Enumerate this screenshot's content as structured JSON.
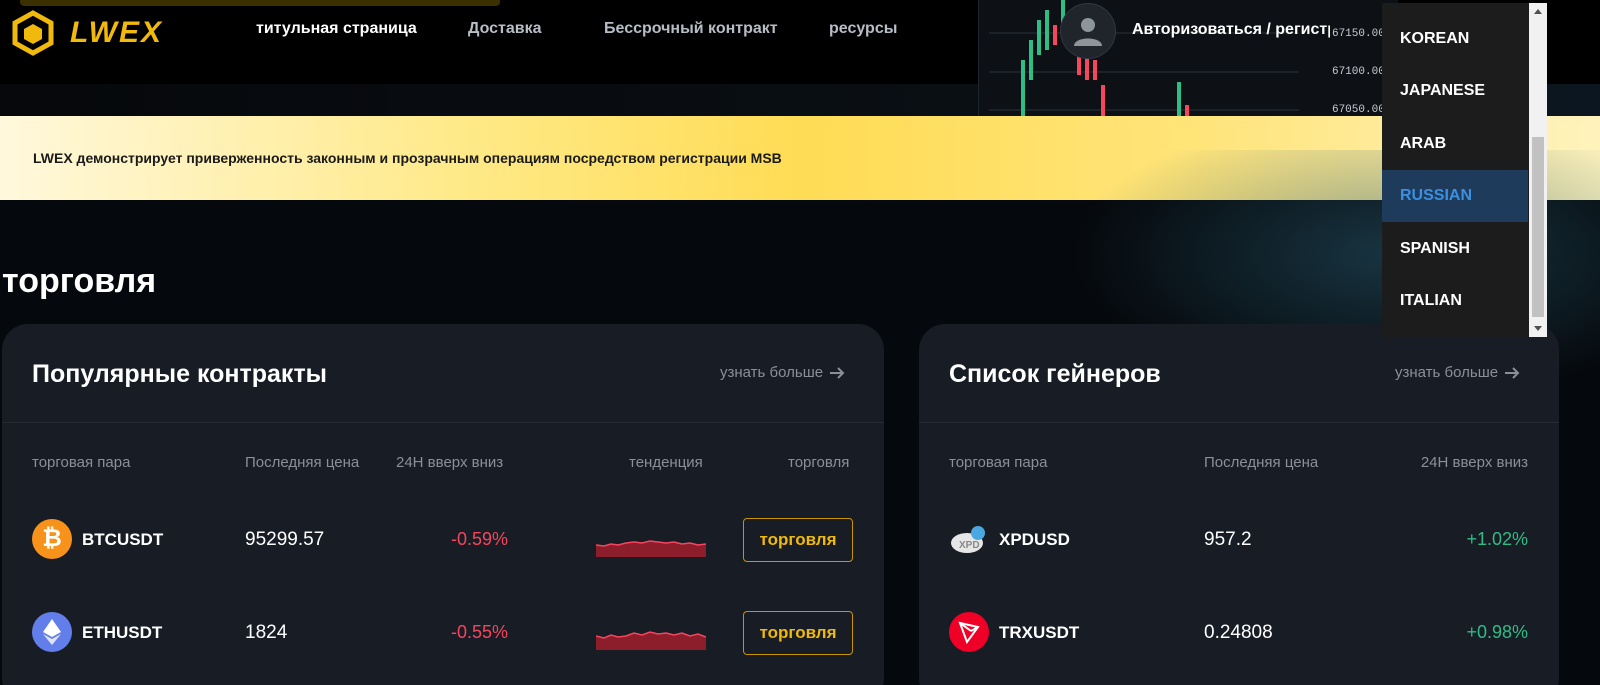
{
  "header": {
    "logo_text": "LWEX",
    "nav": [
      {
        "label": "титульная страница",
        "active": true
      },
      {
        "label": "Доставка",
        "active": false
      },
      {
        "label": "Бессрочный контракт",
        "active": false
      },
      {
        "label": "ресурсы",
        "active": false
      }
    ],
    "login_label": "Авторизоваться / регистр",
    "chart_prices": [
      "67150.0000",
      "67100.0000",
      "67050.0000"
    ]
  },
  "banner": {
    "text": "LWEX демонстрирует приверженность законным и прозрачным операциям посредством регистрации MSB"
  },
  "section_title": "торговля",
  "popular": {
    "title": "Популярные контракты",
    "more": "узнать больше",
    "columns": {
      "pair": "торговая пара",
      "last": "Последняя цена",
      "change": "24H вверх вниз",
      "trend": "тенденция",
      "trade": "торговля"
    },
    "rows": [
      {
        "pair": "BTCUSDT",
        "last": "95299.57",
        "change": "-0.59%",
        "direction": "down",
        "trade": "торговля",
        "icon": "bitcoin-icon",
        "icon_color": "#f7931a"
      },
      {
        "pair": "ETHUSDT",
        "last": "1824",
        "change": "-0.55%",
        "direction": "down",
        "trade": "торговля",
        "icon": "ethereum-icon",
        "icon_color": "#627eea"
      }
    ]
  },
  "gainers": {
    "title": "Список гейнеров",
    "more": "узнать больше",
    "columns": {
      "pair": "торговая пара",
      "last": "Последняя цена",
      "change": "24H вверх вниз"
    },
    "rows": [
      {
        "pair": "XPDUSD",
        "last": "957.2",
        "change": "+1.02%",
        "direction": "up",
        "icon": "palladium-icon",
        "icon_color": "#e6e6e6"
      },
      {
        "pair": "TRXUSDT",
        "last": "0.24808",
        "change": "+0.98%",
        "direction": "up",
        "icon": "tron-icon",
        "icon_color": "#ef0027"
      }
    ]
  },
  "language_menu": {
    "items": [
      "KOREAN",
      "JAPANESE",
      "ARAB",
      "RUSSIAN",
      "SPANISH",
      "ITALIAN"
    ],
    "selected": "RUSSIAN"
  },
  "colors": {
    "accent": "#f0b90b",
    "down": "#f6465d",
    "up": "#2ebd85",
    "selected_lang": "#3d8fe0"
  }
}
